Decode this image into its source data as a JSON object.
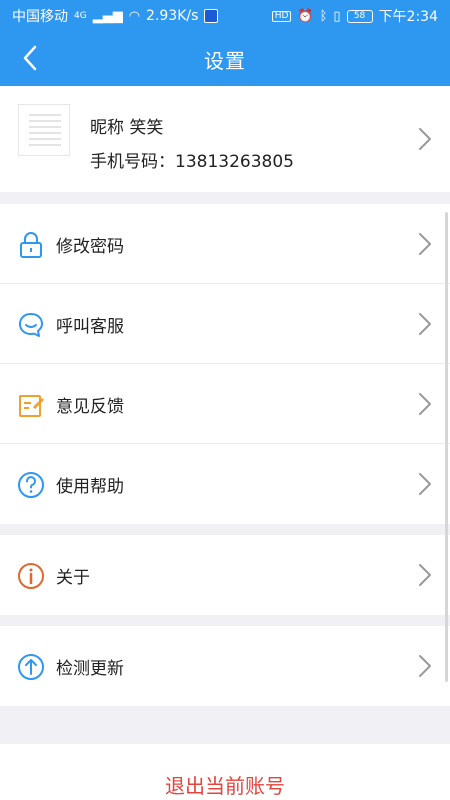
{
  "status_bar": {
    "carrier": "中国移动",
    "network": "4G",
    "speed": "2.93K/s",
    "battery": "58",
    "time": "下午2:34"
  },
  "header": {
    "title": "设置"
  },
  "profile": {
    "nickname": "昵称 笑笑",
    "phone": "手机号码：13813263805"
  },
  "menu": [
    {
      "label": "修改密码",
      "icon": "lock-icon",
      "color": "#2e97f0"
    },
    {
      "label": "呼叫客服",
      "icon": "chat-bubble-icon",
      "color": "#2e97f0"
    },
    {
      "label": "意见反馈",
      "icon": "edit-note-icon",
      "color": "#f0a02e"
    },
    {
      "label": "使用帮助",
      "icon": "help-circle-icon",
      "color": "#2e97f0"
    }
  ],
  "about": {
    "label": "关于",
    "icon": "info-circle-icon",
    "color": "#e2662e"
  },
  "update": {
    "label": "检测更新",
    "icon": "upload-circle-icon",
    "color": "#2e97f0"
  },
  "logout": {
    "label": "退出当前账号",
    "color": "#e2453c"
  }
}
